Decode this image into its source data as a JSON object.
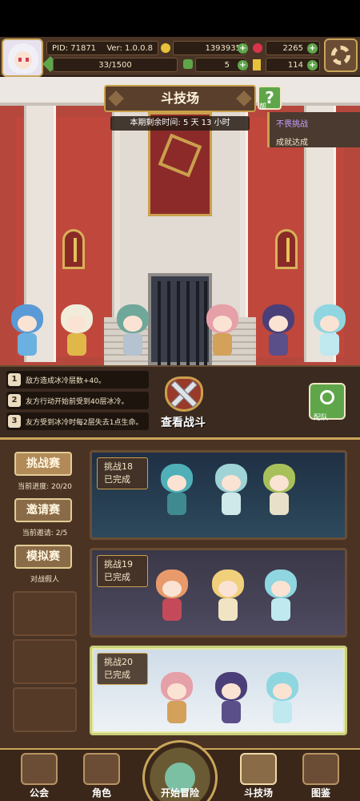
{
  "player": {
    "pid": "PID: 71871",
    "version": "Ver: 1.0.0.8",
    "energy": "33/1500"
  },
  "resources": {
    "gold": "1393935",
    "gems": "2265",
    "clover": "5",
    "keys": "114"
  },
  "arena": {
    "title": "斗技场",
    "timer": "本期剩余时间: 5 天 13 小时",
    "help_label": "帮",
    "achievement_title": "不畏挑战",
    "achievement_status": "成就达成"
  },
  "buffs": [
    {
      "num": "1",
      "text": "敌方造成冰冷层数+40。"
    },
    {
      "num": "2",
      "text": "友方行动开始前受到40层冰冷。"
    },
    {
      "num": "3",
      "text": "友方受到冰冷时每2层失去1点生命。"
    }
  ],
  "actions": {
    "watch_battle": "查看战斗",
    "team": "配队"
  },
  "sidebar": {
    "challenge_label": "挑战赛",
    "challenge_progress": "当前进度: 20/20",
    "invite_label": "邀请赛",
    "invite_progress": "当前邀请: 2/5",
    "sim_label": "模拟赛",
    "sim_sub": "对战假人"
  },
  "challenges": [
    {
      "name": "挑战18",
      "status": "已完成"
    },
    {
      "name": "挑战19",
      "status": "已完成"
    },
    {
      "name": "挑战20",
      "status": "已完成"
    }
  ],
  "nav": {
    "guild": "公会",
    "character": "角色",
    "adventure": "开始冒险",
    "arena": "斗技场",
    "codex": "图鉴"
  },
  "colors": {
    "gold_coin": "#e8c13a",
    "gem": "#d8344a",
    "clover": "#5fa64a",
    "key": "#e8c13a",
    "accent": "#c9a65a"
  }
}
